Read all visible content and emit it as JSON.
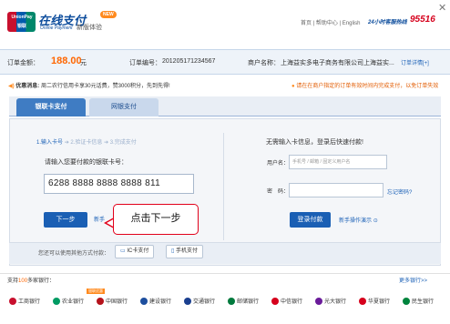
{
  "window": {
    "close_glyph": "✕"
  },
  "header": {
    "logo_text": "UnionPay 银联",
    "brand": "在线支付",
    "brand_sub": "Online Payment",
    "new_badge": "NEW",
    "new_experience": "新版体验",
    "top_links": "首页 | 帮助中心 | English",
    "hotline_label": "24小时客服热线",
    "hotline": "95516"
  },
  "order": {
    "amount_label": "订单金额：",
    "amount_value": "188.00",
    "amount_unit": "元",
    "order_no_label": "订单编号：",
    "order_no": "201205171234567",
    "merchant_label": "商户名称：",
    "merchant": "上海益实多电子商务有限公司上海益实...",
    "detail_link": "订单详情[+]"
  },
  "notice": {
    "label": "优惠消息:",
    "text": "周二农行信用卡享30元话费，赞3000积分，先到先得!",
    "right_text": "请在在商户指定的订单有效时间内完成支付，以免订单失效"
  },
  "tabs": [
    {
      "label": "银联卡支付"
    },
    {
      "label": "网银支付"
    }
  ],
  "card_pay": {
    "steps": [
      "1.输入卡号",
      "2.验证卡信息",
      "3.完成支付"
    ],
    "step_arrow": "➔",
    "card_prompt": "请输入您要付款的银联卡号：",
    "card_number": "6288 8888 8888 8888 811",
    "next_button": "下一步",
    "help_link": "新手",
    "callout": "点击下一步"
  },
  "login_pay": {
    "title": "无需输入卡信息，登录后快速付款!",
    "user_label": "用户名：",
    "user_placeholder": "手机号 / 邮箱 / 固定义用户名",
    "password_label": "密　码：",
    "forgot_link": "忘记密码?",
    "login_button": "登录付款",
    "demo_link": "新手操作演示"
  },
  "other_methods": {
    "label": "您还可以使用其他方式付款：",
    "ic_card": "IC卡支付",
    "mobile": "手机支付"
  },
  "banks": {
    "title_prefix": "支持",
    "count": "100",
    "title_suffix": "多家银行：",
    "more_link": "更多银行>>",
    "preferential": "银联优惠",
    "list": [
      {
        "name": "工商银行",
        "color": "#c8102e"
      },
      {
        "name": "农业银行",
        "color": "#009b63"
      },
      {
        "name": "中国银行",
        "color": "#b5121b"
      },
      {
        "name": "建设银行",
        "color": "#1d4e9e"
      },
      {
        "name": "交通银行",
        "color": "#1a3f8f"
      },
      {
        "name": "邮储银行",
        "color": "#007a3d"
      },
      {
        "name": "中信银行",
        "color": "#d6001c"
      },
      {
        "name": "光大银行",
        "color": "#6a1b9a"
      },
      {
        "name": "华夏银行",
        "color": "#d6001c"
      },
      {
        "name": "民生银行",
        "color": "#00843d"
      }
    ]
  }
}
